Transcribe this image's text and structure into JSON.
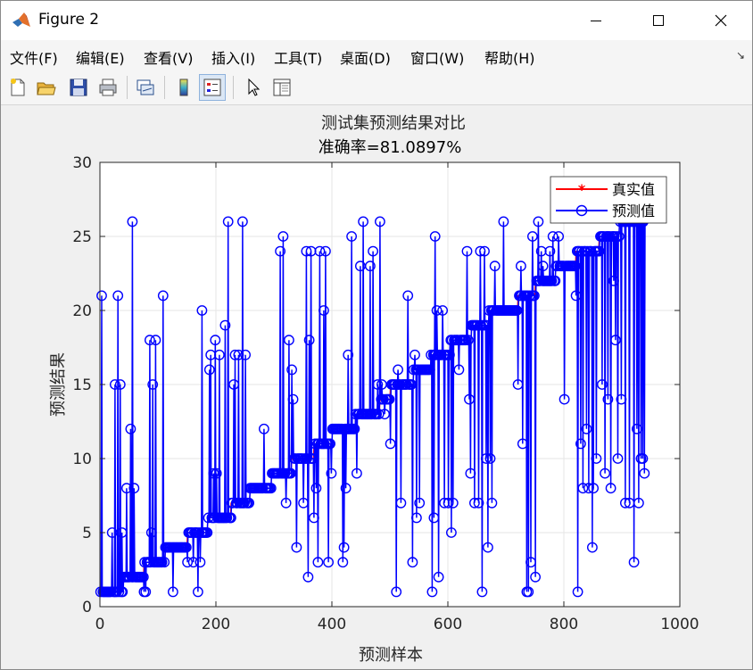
{
  "window": {
    "title": "Figure 2",
    "controls": {
      "minimize": "—",
      "maximize": "☐",
      "close": "✕"
    }
  },
  "menu": {
    "items": [
      {
        "label": "文件(F)"
      },
      {
        "label": "编辑(E)"
      },
      {
        "label": "查看(V)"
      },
      {
        "label": "插入(I)"
      },
      {
        "label": "工具(T)"
      },
      {
        "label": "桌面(D)"
      },
      {
        "label": "窗口(W)"
      },
      {
        "label": "帮助(H)"
      }
    ],
    "overflow_arrow": "↘"
  },
  "toolbar": {
    "buttons": [
      {
        "icon": "new-figure-icon"
      },
      {
        "icon": "open-file-icon"
      },
      {
        "icon": "save-icon"
      },
      {
        "icon": "print-icon"
      },
      {
        "icon": "link-plot-icon"
      },
      {
        "icon": "colorbar-icon"
      },
      {
        "icon": "legend-icon",
        "active": true
      },
      {
        "icon": "pointer-icon"
      },
      {
        "icon": "property-inspector-icon"
      }
    ]
  },
  "chart_data": {
    "type": "line",
    "title": "测试集预测结果对比",
    "subtitle": "准确率=81.0897%",
    "xlabel": "预测样本",
    "ylabel": "预测结果",
    "xlim": [
      0,
      1000
    ],
    "ylim": [
      0,
      30
    ],
    "x_ticks": [
      "0",
      "200",
      "400",
      "600",
      "800",
      "1000"
    ],
    "y_ticks": [
      "0",
      "5",
      "10",
      "15",
      "20",
      "25",
      "30"
    ],
    "grid": true,
    "legend_position": "top-right",
    "colors": {
      "true": "#ff0000",
      "pred": "#0000ff"
    },
    "series": [
      {
        "name": "真实值",
        "marker": "*"
      },
      {
        "name": "预测值",
        "marker": "o"
      }
    ],
    "class_ranges": [
      [
        1,
        0,
        40
      ],
      [
        2,
        40,
        75
      ],
      [
        3,
        75,
        112
      ],
      [
        4,
        112,
        150
      ],
      [
        5,
        150,
        185
      ],
      [
        6,
        185,
        225
      ],
      [
        7,
        225,
        258
      ],
      [
        8,
        258,
        295
      ],
      [
        9,
        295,
        330
      ],
      [
        10,
        330,
        368
      ],
      [
        11,
        368,
        400
      ],
      [
        12,
        400,
        440
      ],
      [
        13,
        440,
        482
      ],
      [
        14,
        482,
        500
      ],
      [
        15,
        500,
        540
      ],
      [
        16,
        540,
        570
      ],
      [
        17,
        570,
        603
      ],
      [
        18,
        603,
        640
      ],
      [
        19,
        640,
        670
      ],
      [
        20,
        670,
        720
      ],
      [
        21,
        720,
        750
      ],
      [
        22,
        750,
        785
      ],
      [
        23,
        785,
        820
      ],
      [
        24,
        820,
        860
      ],
      [
        25,
        860,
        895
      ],
      [
        26,
        895,
        940
      ]
    ],
    "prediction_spikes": [
      [
        2,
        21
      ],
      [
        20,
        5
      ],
      [
        25,
        15
      ],
      [
        30,
        21
      ],
      [
        34,
        15
      ],
      [
        37,
        5
      ],
      [
        45,
        8
      ],
      [
        52,
        12
      ],
      [
        55,
        26
      ],
      [
        58,
        8
      ],
      [
        75,
        1
      ],
      [
        78,
        1
      ],
      [
        85,
        18
      ],
      [
        88,
        5
      ],
      [
        90,
        15
      ],
      [
        95,
        18
      ],
      [
        108,
        21
      ],
      [
        125,
        1
      ],
      [
        150,
        3
      ],
      [
        160,
        3
      ],
      [
        168,
        1
      ],
      [
        172,
        3
      ],
      [
        175,
        20
      ],
      [
        188,
        16
      ],
      [
        190,
        17
      ],
      [
        195,
        9
      ],
      [
        198,
        18
      ],
      [
        200,
        9
      ],
      [
        205,
        17
      ],
      [
        215,
        19
      ],
      [
        220,
        26
      ],
      [
        225,
        6
      ],
      [
        230,
        15
      ],
      [
        232,
        17
      ],
      [
        238,
        17
      ],
      [
        245,
        26
      ],
      [
        250,
        17
      ],
      [
        282,
        12
      ],
      [
        310,
        24
      ],
      [
        315,
        25
      ],
      [
        320,
        7
      ],
      [
        325,
        18
      ],
      [
        330,
        16
      ],
      [
        332,
        14
      ],
      [
        338,
        4
      ],
      [
        350,
        7
      ],
      [
        355,
        24
      ],
      [
        358,
        2
      ],
      [
        360,
        18
      ],
      [
        363,
        24
      ],
      [
        368,
        6
      ],
      [
        372,
        8
      ],
      [
        375,
        3
      ],
      [
        378,
        24
      ],
      [
        385,
        20
      ],
      [
        388,
        24
      ],
      [
        393,
        3
      ],
      [
        398,
        9
      ],
      [
        418,
        3
      ],
      [
        420,
        4
      ],
      [
        423,
        8
      ],
      [
        427,
        17
      ],
      [
        433,
        25
      ],
      [
        442,
        9
      ],
      [
        448,
        23
      ],
      [
        453,
        26
      ],
      [
        465,
        23
      ],
      [
        470,
        24
      ],
      [
        478,
        15
      ],
      [
        482,
        26
      ],
      [
        485,
        15
      ],
      [
        490,
        13
      ],
      [
        500,
        11
      ],
      [
        510,
        1
      ],
      [
        513,
        16
      ],
      [
        518,
        7
      ],
      [
        530,
        21
      ],
      [
        538,
        3
      ],
      [
        542,
        17
      ],
      [
        545,
        6
      ],
      [
        550,
        7
      ],
      [
        572,
        1
      ],
      [
        575,
        6
      ],
      [
        577,
        25
      ],
      [
        580,
        20
      ],
      [
        583,
        2
      ],
      [
        590,
        20
      ],
      [
        593,
        7
      ],
      [
        600,
        7
      ],
      [
        605,
        5
      ],
      [
        608,
        7
      ],
      [
        618,
        16
      ],
      [
        632,
        24
      ],
      [
        636,
        14
      ],
      [
        638,
        9
      ],
      [
        645,
        7
      ],
      [
        652,
        7
      ],
      [
        655,
        24
      ],
      [
        658,
        1
      ],
      [
        662,
        24
      ],
      [
        665,
        10
      ],
      [
        668,
        4
      ],
      [
        672,
        10
      ],
      [
        675,
        7
      ],
      [
        680,
        23
      ],
      [
        695,
        26
      ],
      [
        700,
        20
      ],
      [
        720,
        15
      ],
      [
        725,
        23
      ],
      [
        728,
        11
      ],
      [
        735,
        1
      ],
      [
        738,
        1
      ],
      [
        742,
        3
      ],
      [
        745,
        25
      ],
      [
        750,
        2
      ],
      [
        755,
        26
      ],
      [
        760,
        24
      ],
      [
        763,
        23
      ],
      [
        775,
        24
      ],
      [
        780,
        25
      ],
      [
        790,
        25
      ],
      [
        800,
        14
      ],
      [
        820,
        21
      ],
      [
        823,
        1
      ],
      [
        828,
        11
      ],
      [
        832,
        8
      ],
      [
        838,
        12
      ],
      [
        842,
        8
      ],
      [
        848,
        4
      ],
      [
        850,
        8
      ],
      [
        855,
        10
      ],
      [
        860,
        24
      ],
      [
        865,
        15
      ],
      [
        870,
        9
      ],
      [
        875,
        14
      ],
      [
        880,
        8
      ],
      [
        885,
        22
      ],
      [
        888,
        18
      ],
      [
        892,
        10
      ],
      [
        898,
        14
      ],
      [
        905,
        7
      ],
      [
        912,
        7
      ],
      [
        920,
        3
      ],
      [
        925,
        12
      ],
      [
        928,
        7
      ],
      [
        932,
        10
      ],
      [
        935,
        10
      ],
      [
        938,
        9
      ]
    ]
  }
}
